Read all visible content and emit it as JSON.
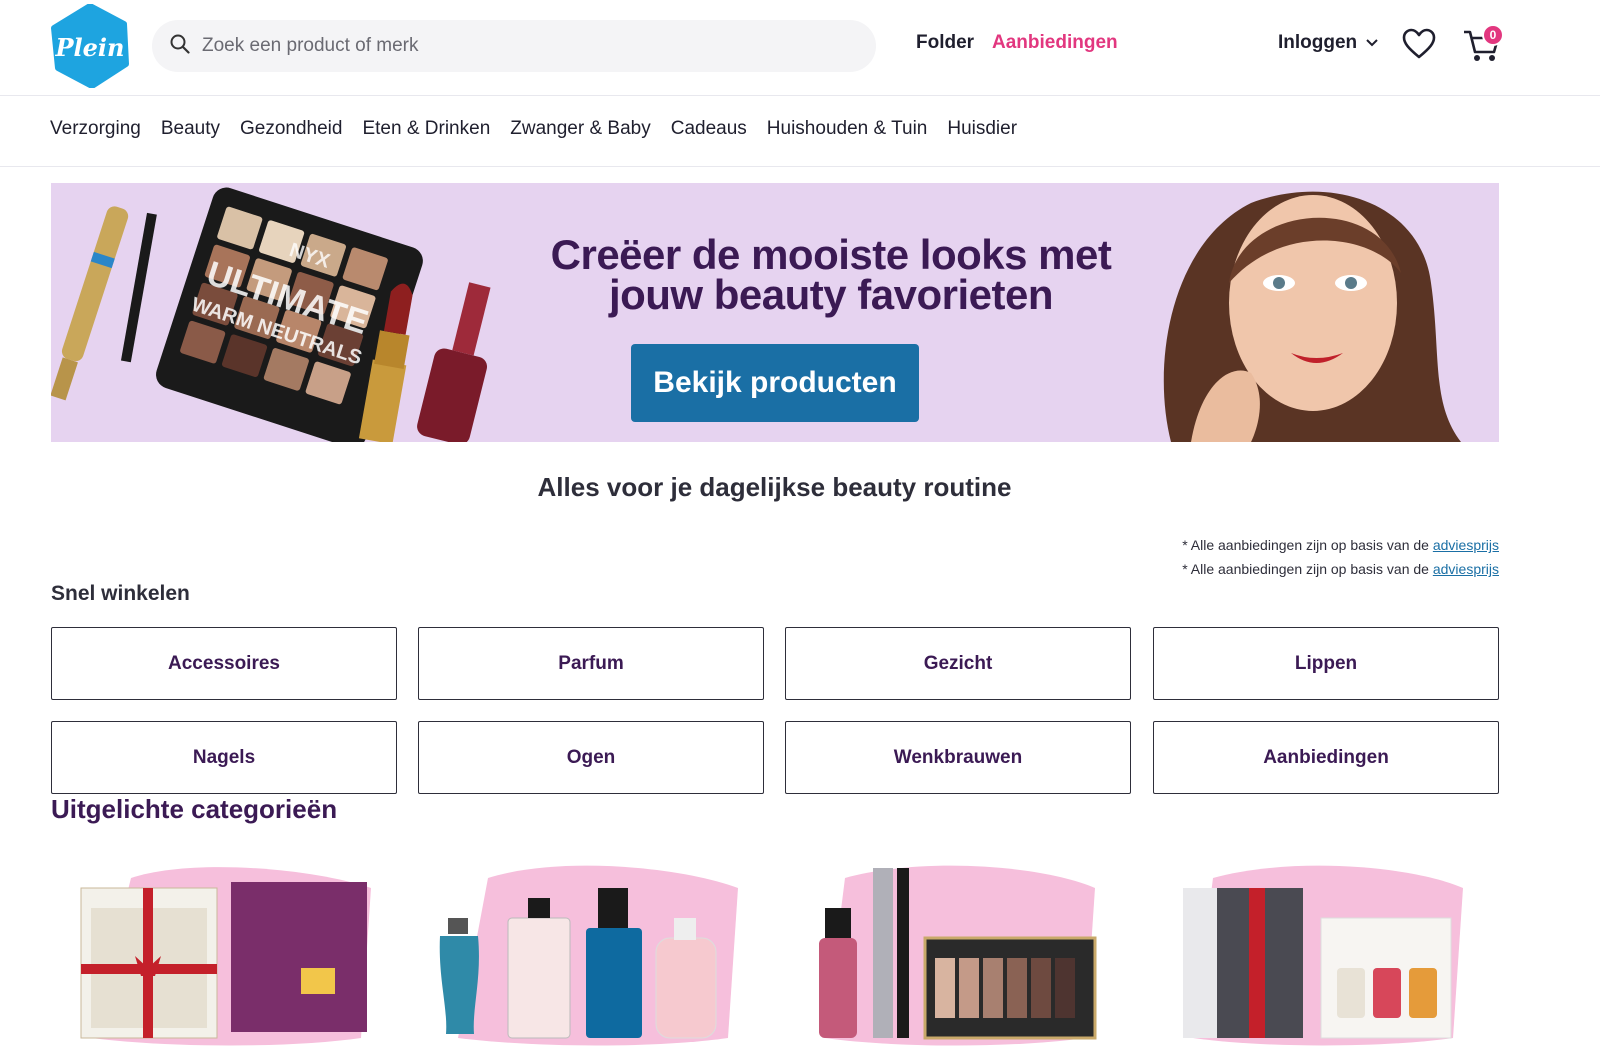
{
  "header": {
    "logo_text": "Plein",
    "search_placeholder": "Zoek een product of merk",
    "folder_label": "Folder",
    "deals_label": "Aanbiedingen",
    "login_label": "Inloggen",
    "cart_count": "0"
  },
  "category_nav": [
    "Verzorging",
    "Beauty",
    "Gezondheid",
    "Eten & Drinken",
    "Zwanger & Baby",
    "Cadeaus",
    "Huishouden & Tuin",
    "Huisdier"
  ],
  "banner": {
    "title_line1": "Creëer de mooiste looks met",
    "title_line2": "jouw beauty favorieten",
    "button_label": "Bekijk producten",
    "palette_text_1": "ULTIMATE",
    "palette_text_2": "WARM NEUTRALS",
    "palette_brand": "NYX"
  },
  "section_heading": "Alles voor je dagelijkse beauty routine",
  "disclaimer": {
    "text": "* Alle aanbiedingen zijn op basis van de",
    "link": "adviesprijs"
  },
  "quick_shop": {
    "title": "Snel winkelen",
    "buttons": [
      "Accessoires",
      "Parfum",
      "Gezicht",
      "Lippen",
      "Nagels",
      "Ogen",
      "Wenkbrauwen",
      "Aanbiedingen"
    ]
  },
  "featured": {
    "title": "Uitgelichte categorieën"
  },
  "colors": {
    "accent_pink": "#e2377f",
    "brand_blue": "#1a6fa5",
    "banner_bg": "#e6d3f0",
    "heading_purple": "#3b1a54"
  }
}
